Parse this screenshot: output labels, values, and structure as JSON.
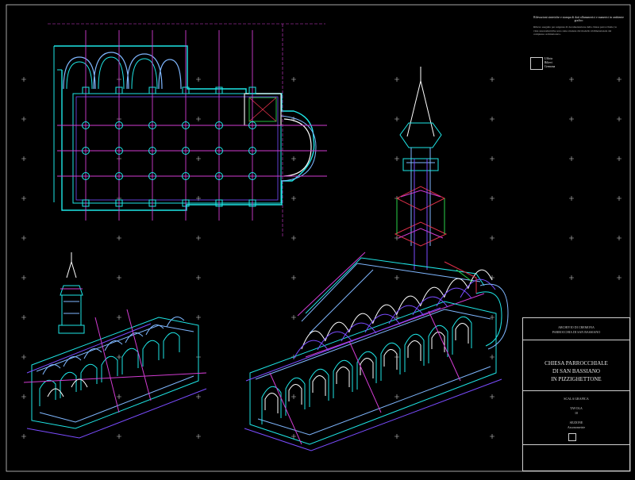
{
  "sheet": {
    "background": "#000000",
    "line_colors": {
      "cyan": "#1ee6e6",
      "light_blue": "#7fb7ff",
      "magenta": "#d23cd2",
      "violet": "#7a4cff",
      "white": "#ffffff",
      "red": "#e0304a",
      "green": "#2ad24a"
    }
  },
  "title_block": {
    "archive_line1": "ARCHIVIO DI CREMONA",
    "archive_line2": "PARROCCHIA DI SAN BASSIANO",
    "title_line1": "CHIESA PARROCCHIALE",
    "title_line2": "DI SAN BASSIANO",
    "title_line3": "IN PIZZIGHETTONE",
    "scale_label": "SCALA GRAFICA",
    "table_label": "TAVOLA",
    "table_number": "10",
    "note_label": "SEZIONE",
    "note_value": "Assonometrie"
  },
  "notes_block": {
    "heading": "Rilevazioni sintetiche e stampa di dati alfanumerici e numerici in ambiente grafico",
    "body": "Rilievo eseguito per esigenze di documentazione della chiesa parrocchiale; le viste assonometriche sono state ottenute dal modello tridimensionale del complesso architettonico.",
    "stamp_lines": [
      "Ufficio",
      "Rilievi",
      "Cremona"
    ]
  }
}
